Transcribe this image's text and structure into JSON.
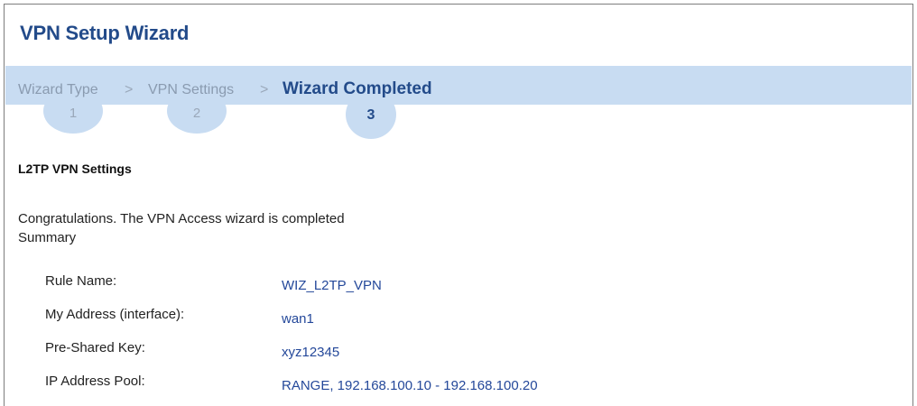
{
  "window": {
    "title": "VPN Setup Wizard"
  },
  "steps": [
    {
      "label": "Wizard Type",
      "number": "1",
      "active": false
    },
    {
      "label": "VPN Settings",
      "number": "2",
      "active": false
    },
    {
      "label": "Wizard Completed",
      "number": "3",
      "active": true
    }
  ],
  "separator": ">",
  "section": {
    "title": "L2TP VPN Settings"
  },
  "messages": {
    "congrats": "Congratulations. The VPN Access wizard is completed",
    "summary": "Summary"
  },
  "summary_rows": [
    {
      "label": "Rule Name:",
      "value": "WIZ_L2TP_VPN"
    },
    {
      "label": "My Address (interface):",
      "value": "wan1"
    },
    {
      "label": "Pre-Shared Key:",
      "value": "xyz12345"
    },
    {
      "label": "IP Address Pool:",
      "value": "RANGE, 192.168.100.10 - 192.168.100.20"
    }
  ],
  "colors": {
    "title": "#234b8a",
    "stepbar": "#c8dcf2",
    "value": "#24489a"
  }
}
